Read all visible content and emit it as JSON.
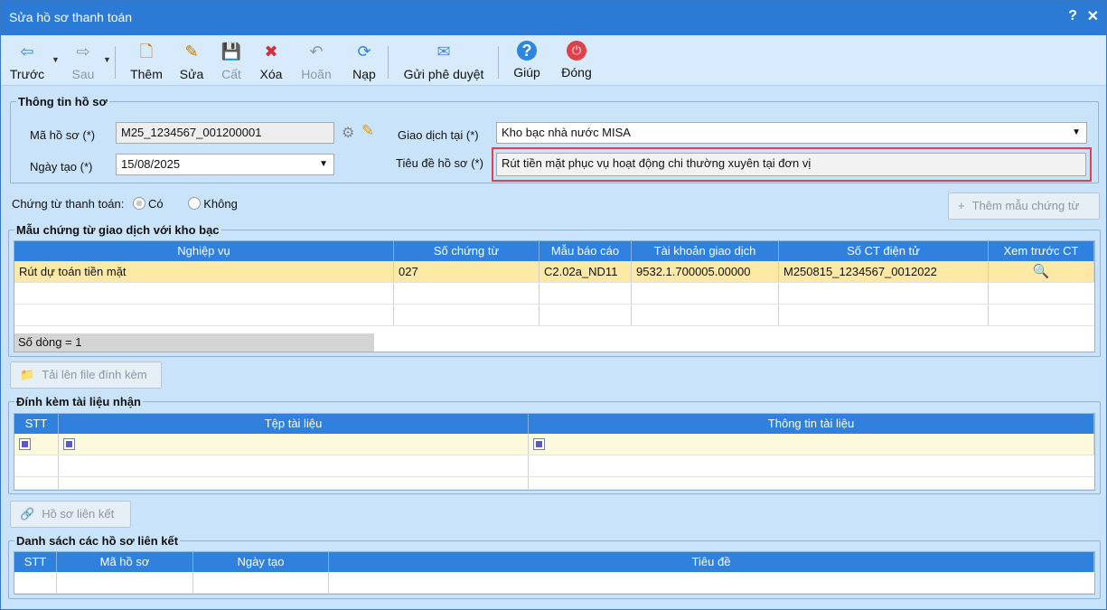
{
  "window": {
    "title": "Sửa hồ sơ thanh toán",
    "help": "?",
    "close": "✕"
  },
  "toolbar": [
    {
      "name": "back-button",
      "icon": "⇦",
      "label": "Trước",
      "enabled": true
    },
    {
      "name": "next-button",
      "icon": "⇨",
      "label": "Sau",
      "enabled": false
    },
    {
      "name": "add-button",
      "icon": "🗋",
      "label": "Thêm",
      "enabled": true
    },
    {
      "name": "edit-button",
      "icon": "✎",
      "label": "Sửa",
      "enabled": true
    },
    {
      "name": "save-button",
      "icon": "💾",
      "label": "Cất",
      "enabled": false
    },
    {
      "name": "delete-button",
      "icon": "✖",
      "label": "Xóa",
      "enabled": true
    },
    {
      "name": "undo-button",
      "icon": "↶",
      "label": "Hoãn",
      "enabled": false
    },
    {
      "name": "reload-button",
      "icon": "⟳",
      "label": "Nạp",
      "enabled": true
    },
    {
      "name": "send-approval-button",
      "icon": "✉",
      "label": "Gửi phê duyệt",
      "enabled": true
    },
    {
      "name": "help-button",
      "icon": "?",
      "label": "Giúp",
      "enabled": true
    },
    {
      "name": "close-button",
      "icon": "⏻",
      "label": "Đóng",
      "enabled": true
    }
  ],
  "info": {
    "legend": "Thông tin hồ sơ",
    "code_label": "Mã hồ sơ (*)",
    "code_value": "M25_1234567_001200001",
    "date_label": "Ngày tạo (*)",
    "date_value": "15/08/2025",
    "place_label": "Giao dịch tại (*)",
    "place_value": "Kho bạc nhà nước MISA",
    "subject_label": "Tiêu đề hồ sơ (*)",
    "subject_value": "Rút tiền mặt phục vụ hoạt động chi thường xuyên tại đơn vị"
  },
  "payment_docs": {
    "label": "Chứng từ thanh toán:",
    "yes": "Có",
    "no": "Không",
    "add_template": "Thêm mẫu chứng từ"
  },
  "templates": {
    "legend": "Mẫu chứng từ giao dịch với kho bạc",
    "headers": [
      "Nghiệp vụ",
      "Số chứng từ",
      "Mẫu báo cáo",
      "Tài khoản giao dịch",
      "Số CT điện tử",
      "Xem trước CT"
    ],
    "rows": [
      [
        "Rút dự toán tiền mặt",
        "027",
        "C2.02a_ND11",
        "9532.1.700005.00000",
        "M250815_1234567_0012022",
        ""
      ]
    ],
    "footer": "Số dòng = 1"
  },
  "upload": {
    "label": "Tải lên file đính kèm"
  },
  "attachments": {
    "legend": "Đính kèm tài liệu nhận",
    "headers": [
      "STT",
      "Tệp tài liệu",
      "Thông tin tài liệu"
    ]
  },
  "linked_button": {
    "label": "Hồ sơ liên kết"
  },
  "linked": {
    "legend": "Danh sách các hồ sơ liên kết",
    "headers": [
      "STT",
      "Mã hồ sơ",
      "Ngày tạo",
      "Tiêu đề"
    ]
  },
  "colors": {
    "title_bar": "#2b7bd6",
    "grid_header": "#2f81dd",
    "selected_row": "#fde9a5",
    "highlight_border": "#e04050"
  }
}
